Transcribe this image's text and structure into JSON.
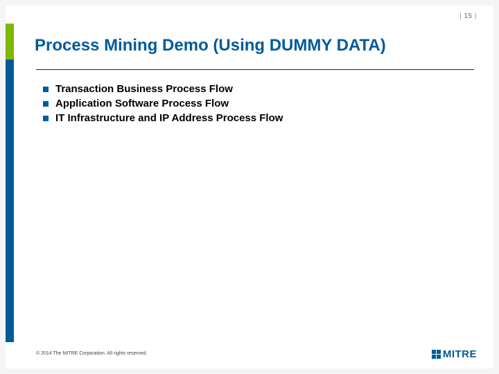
{
  "page_number": "15",
  "title": "Process Mining Demo (Using DUMMY DATA)",
  "bullets": [
    "Transaction Business Process Flow",
    "Application Software Process Flow",
    "IT Infrastructure and IP Address Process Flow"
  ],
  "copyright": "© 2014 The MITRE Corporation. All rights reserved.",
  "logo_text": "MITRE"
}
